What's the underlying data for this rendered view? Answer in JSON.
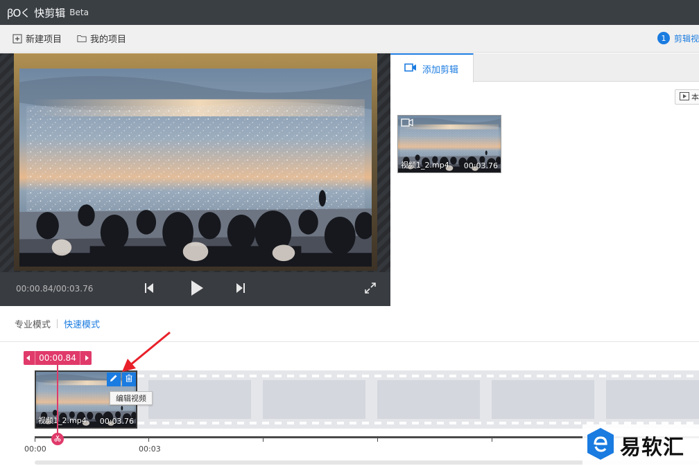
{
  "titlebar": {
    "logo_mark": "ꞵOく",
    "app_name": "快剪辑",
    "badge": "Beta"
  },
  "toolbar": {
    "new_project": "新建项目",
    "my_projects": "我的项目",
    "step_number": "1",
    "step_label": "剪辑视"
  },
  "player": {
    "timecode": "00:00.84/00:03.76"
  },
  "side": {
    "tab_add_clip": "添加剪辑",
    "import_button": "本",
    "clip": {
      "name": "视频1_2.mp4",
      "duration": "00:03.76"
    }
  },
  "modes": {
    "pro": "专业模式",
    "fast": "快速模式"
  },
  "timeline": {
    "cursor_time": "00:00.84",
    "clip": {
      "name": "视频1_2.mp4",
      "duration": "00:03.76"
    },
    "tooltip": "编辑视频",
    "ruler_labels": [
      "00:00",
      "00:03"
    ]
  },
  "watermark": {
    "text": "易软汇"
  },
  "colors": {
    "accent": "#1a7be0",
    "playhead": "#e03a6a",
    "titlebar": "#3a3f44",
    "annotation": "#e8202a"
  },
  "icons": {
    "new_project": "plus-square-icon",
    "my_projects": "folder-icon",
    "prev": "skip-back-icon",
    "play": "play-icon",
    "next": "skip-forward-icon",
    "fullscreen": "expand-icon",
    "tab": "video-camera-icon",
    "edit": "pencil-icon",
    "delete": "trash-icon",
    "scissors": "scissors-icon"
  }
}
